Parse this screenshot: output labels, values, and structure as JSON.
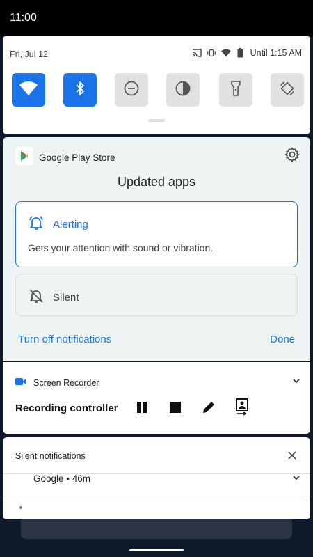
{
  "status_bar": {
    "time": "11:00"
  },
  "quick_settings": {
    "date": "Fri, Jul 12",
    "battery_text": "Until 1:15 AM",
    "tiles": [
      {
        "name": "wifi",
        "active": true
      },
      {
        "name": "bluetooth",
        "active": true
      },
      {
        "name": "do-not-disturb",
        "active": false
      },
      {
        "name": "invert-colors",
        "active": false
      },
      {
        "name": "flashlight",
        "active": false
      },
      {
        "name": "auto-rotate",
        "active": false
      }
    ]
  },
  "channel_settings": {
    "app_name": "Google Play Store",
    "title": "Updated apps",
    "alerting": {
      "label": "Alerting",
      "description": "Gets your attention with sound or vibration.",
      "selected": true
    },
    "silent": {
      "label": "Silent",
      "selected": false
    },
    "turn_off_label": "Turn off notifications",
    "done_label": "Done"
  },
  "recorder": {
    "app_name": "Screen Recorder",
    "title": "Recording controller",
    "actions": [
      "pause-icon",
      "stop-icon",
      "edit-icon",
      "screen-share-icon"
    ]
  },
  "silent_notifications": {
    "header": "Silent notifications",
    "item": "Google • 46m"
  },
  "colors": {
    "accent": "#1a73e8",
    "card_bg": "#eef4f4",
    "status_bar": "#000000"
  }
}
